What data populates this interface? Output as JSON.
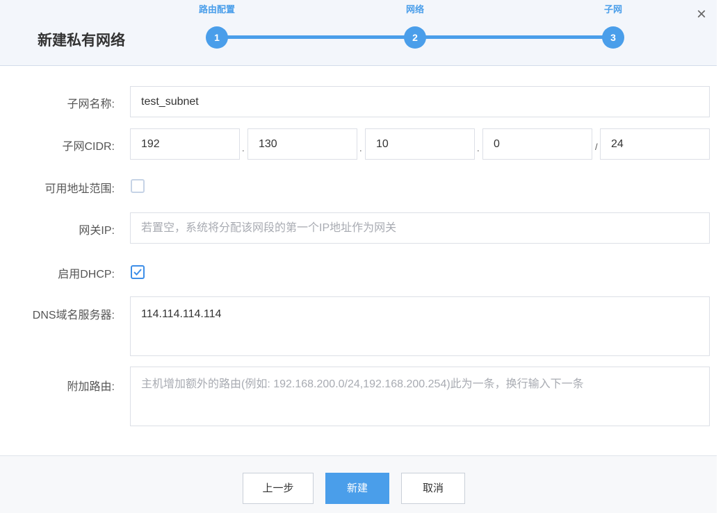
{
  "dialog": {
    "title": "新建私有网络",
    "close_icon": "×"
  },
  "steps": [
    {
      "label": "路由配置",
      "number": "1"
    },
    {
      "label": "网络",
      "number": "2"
    },
    {
      "label": "子网",
      "number": "3"
    }
  ],
  "form": {
    "subnet_name": {
      "label": "子网名称:",
      "value": "test_subnet"
    },
    "cidr": {
      "label": "子网CIDR:",
      "octets": [
        "192",
        "130",
        "10",
        "0"
      ],
      "dot": ".",
      "slash": "/",
      "prefix": "24"
    },
    "address_range": {
      "label": "可用地址范围:",
      "checked": false
    },
    "gateway": {
      "label": "网关IP:",
      "placeholder": "若置空，系统将分配该网段的第一个IP地址作为网关"
    },
    "dhcp": {
      "label": "启用DHCP:",
      "checked": true
    },
    "dns": {
      "label": "DNS域名服务器:",
      "value": "114.114.114.114"
    },
    "routes": {
      "label": "附加路由:",
      "placeholder": "主机增加额外的路由(例如: 192.168.200.0/24,192.168.200.254)此为一条，换行输入下一条"
    }
  },
  "footer": {
    "prev_label": "上一步",
    "create_label": "新建",
    "cancel_label": "取消"
  },
  "colors": {
    "accent": "#4a9eea"
  }
}
